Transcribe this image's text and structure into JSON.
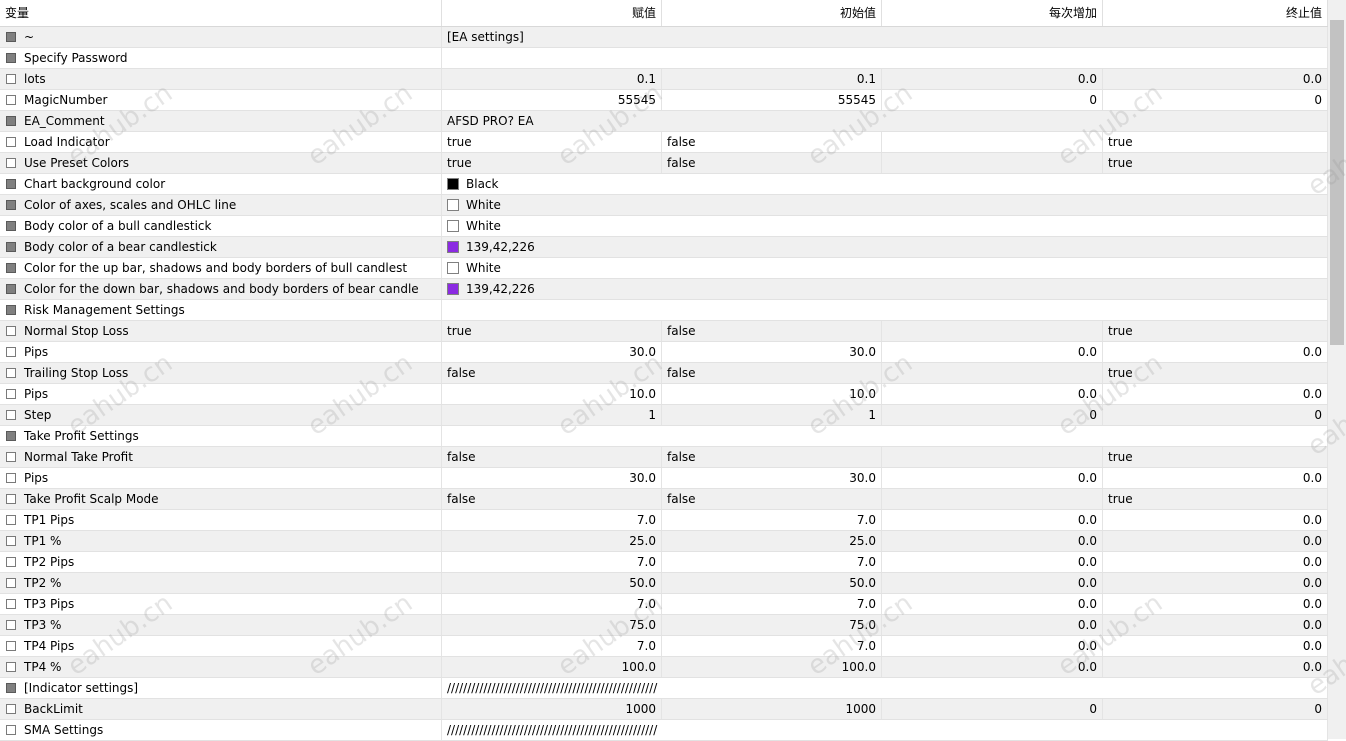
{
  "header": [
    "变量",
    "赋值",
    "初始值",
    "每次增加",
    "终止值"
  ],
  "rows": [
    {
      "name": "~",
      "section": true,
      "value": "[EA settings]",
      "span": true
    },
    {
      "name": "Specify Password",
      "section": true,
      "value": "",
      "span": true
    },
    {
      "name": "lots",
      "section": false,
      "value": "0.1",
      "start": "0.1",
      "step": "0.0",
      "stop": "0.0",
      "numeric": true
    },
    {
      "name": "MagicNumber",
      "section": false,
      "value": "55545",
      "start": "55545",
      "step": "0",
      "stop": "0",
      "numeric": true
    },
    {
      "name": "EA_Comment",
      "section": true,
      "value": "AFSD PRO? EA",
      "span": true
    },
    {
      "name": "Load Indicator",
      "section": false,
      "value": "true",
      "start": "false",
      "step": "",
      "stop": "true"
    },
    {
      "name": "Use Preset Colors",
      "section": false,
      "value": "true",
      "start": "false",
      "step": "",
      "stop": "true"
    },
    {
      "name": "Chart background color",
      "section": true,
      "value": "Black",
      "swatch": "#000000",
      "span": true
    },
    {
      "name": "Color of axes, scales and OHLC line",
      "section": true,
      "value": "White",
      "swatch": "#ffffff",
      "span": true
    },
    {
      "name": "Body color of a bull candlestick",
      "section": true,
      "value": "White",
      "swatch": "#ffffff",
      "span": true
    },
    {
      "name": "Body color of a bear candlestick",
      "section": true,
      "value": "139,42,226",
      "swatch": "#8b2ae2",
      "span": true
    },
    {
      "name": "Color for the up bar, shadows and body borders of bull candlest",
      "section": true,
      "value": "White",
      "swatch": "#ffffff",
      "span": true
    },
    {
      "name": "Color for the down bar, shadows and body borders of bear candle",
      "section": true,
      "value": "139,42,226",
      "swatch": "#8b2ae2",
      "span": true
    },
    {
      "name": "Risk Management Settings",
      "section": true,
      "value": "",
      "span": true
    },
    {
      "name": "Normal Stop Loss",
      "section": false,
      "value": "true",
      "start": "false",
      "step": "",
      "stop": "true"
    },
    {
      "name": "Pips",
      "section": false,
      "value": "30.0",
      "start": "30.0",
      "step": "0.0",
      "stop": "0.0",
      "numeric": true
    },
    {
      "name": "Trailing Stop Loss",
      "section": false,
      "value": "false",
      "start": "false",
      "step": "",
      "stop": "true"
    },
    {
      "name": "Pips",
      "section": false,
      "value": "10.0",
      "start": "10.0",
      "step": "0.0",
      "stop": "0.0",
      "numeric": true
    },
    {
      "name": "Step",
      "section": false,
      "value": "1",
      "start": "1",
      "step": "0",
      "stop": "0",
      "numeric": true
    },
    {
      "name": "Take Profit Settings",
      "section": true,
      "value": "",
      "span": true
    },
    {
      "name": "Normal Take Profit",
      "section": false,
      "value": "false",
      "start": "false",
      "step": "",
      "stop": "true"
    },
    {
      "name": "Pips",
      "section": false,
      "value": "30.0",
      "start": "30.0",
      "step": "0.0",
      "stop": "0.0",
      "numeric": true
    },
    {
      "name": "Take Profit Scalp Mode",
      "section": false,
      "value": "false",
      "start": "false",
      "step": "",
      "stop": "true"
    },
    {
      "name": "TP1 Pips",
      "section": false,
      "value": "7.0",
      "start": "7.0",
      "step": "0.0",
      "stop": "0.0",
      "numeric": true
    },
    {
      "name": "TP1 %",
      "section": false,
      "value": "25.0",
      "start": "25.0",
      "step": "0.0",
      "stop": "0.0",
      "numeric": true
    },
    {
      "name": "TP2 Pips",
      "section": false,
      "value": "7.0",
      "start": "7.0",
      "step": "0.0",
      "stop": "0.0",
      "numeric": true
    },
    {
      "name": "TP2 %",
      "section": false,
      "value": "50.0",
      "start": "50.0",
      "step": "0.0",
      "stop": "0.0",
      "numeric": true
    },
    {
      "name": "TP3 Pips",
      "section": false,
      "value": "7.0",
      "start": "7.0",
      "step": "0.0",
      "stop": "0.0",
      "numeric": true
    },
    {
      "name": "TP3 %",
      "section": false,
      "value": "75.0",
      "start": "75.0",
      "step": "0.0",
      "stop": "0.0",
      "numeric": true
    },
    {
      "name": "TP4 Pips",
      "section": false,
      "value": "7.0",
      "start": "7.0",
      "step": "0.0",
      "stop": "0.0",
      "numeric": true
    },
    {
      "name": "TP4 %",
      "section": false,
      "value": "100.0",
      "start": "100.0",
      "step": "0.0",
      "stop": "0.0",
      "numeric": true
    },
    {
      "name": "[Indicator settings]",
      "section": true,
      "value": "////////////////////////////////////////////////////",
      "span": true
    },
    {
      "name": "BackLimit",
      "section": false,
      "value": "1000",
      "start": "1000",
      "step": "0",
      "stop": "0",
      "numeric": true
    },
    {
      "name": "SMA Settings",
      "section": false,
      "value": "////////////////////////////////////////////////////",
      "span": true
    }
  ],
  "watermark": "eahub.cn"
}
